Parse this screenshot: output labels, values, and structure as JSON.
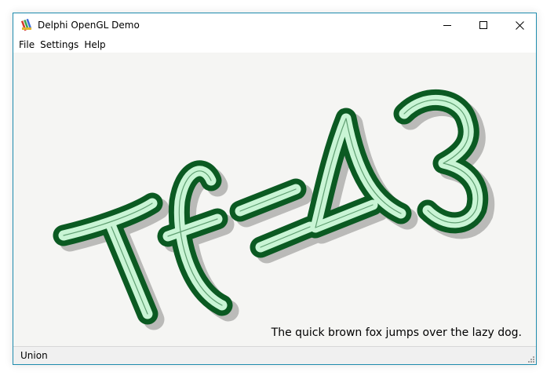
{
  "window": {
    "title": "Delphi OpenGL Demo",
    "app_icon": "delphi-app-icon",
    "controls": {
      "minimize_icon": "minimize-icon",
      "maximize_icon": "maximize-icon",
      "close_icon": "close-icon"
    }
  },
  "menu": {
    "items": [
      {
        "label": "File"
      },
      {
        "label": "Settings"
      },
      {
        "label": "Help"
      }
    ]
  },
  "canvas": {
    "text_3d": "Tf=43",
    "pangram": "The quick brown fox jumps over the lazy dog.",
    "colors": {
      "background": "#f5f5f3",
      "glyph_outline": "#0b5a22",
      "glyph_fill": "#c9f5d5",
      "shadow": "#b0b0ae"
    }
  },
  "status": {
    "text": "Union"
  }
}
